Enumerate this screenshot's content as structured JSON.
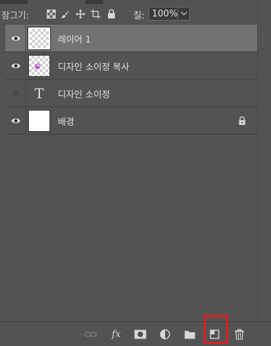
{
  "lock_bar": {
    "label": "잠그기:",
    "icons": [
      "lock-transparent-pixels-icon",
      "lock-image-pixels-icon",
      "lock-position-icon",
      "lock-artboard-icon",
      "lock-all-icon"
    ],
    "fill_label": "칠:",
    "fill_value": "100%"
  },
  "layers": [
    {
      "name": "레이어 1",
      "visible": true,
      "selected": true,
      "thumb": "transparent"
    },
    {
      "name": "디자인 소이정 복사",
      "visible": true,
      "selected": false,
      "thumb": "smart-text"
    },
    {
      "name": "디자인 소이정",
      "visible": false,
      "selected": false,
      "thumb": "type"
    },
    {
      "name": "배경",
      "visible": true,
      "selected": false,
      "thumb": "white",
      "locked": true
    }
  ],
  "bottom_bar": {
    "buttons": [
      "link-layers-icon",
      "fx-icon",
      "mask-icon",
      "adjustment-icon",
      "group-folder-icon",
      "new-layer-icon",
      "trash-icon"
    ],
    "fx_text": "fx",
    "highlighted": "new-layer-icon"
  },
  "colors": {
    "panel_bg": "#535353",
    "selected_row": "#727272",
    "highlight": "#e51d1d"
  }
}
